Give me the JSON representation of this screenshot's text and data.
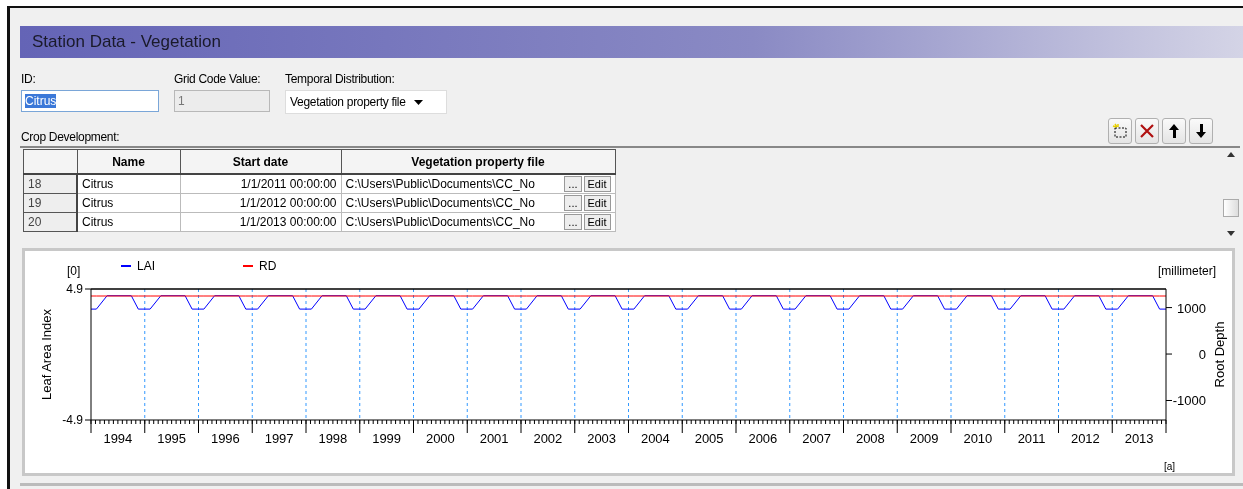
{
  "panel": {
    "title": "Station Data - Vegetation"
  },
  "fields": {
    "id": {
      "label": "ID:",
      "value": "Citrus",
      "selected": true
    },
    "grid_code": {
      "label": "Grid Code Value:",
      "value": "1",
      "disabled": true
    },
    "temporal_distribution": {
      "label": "Temporal Distribution:",
      "value": "Vegetation property file"
    }
  },
  "crop_development": {
    "label": "Crop Development:",
    "columns": [
      "Name",
      "Start date",
      "Vegetation property file"
    ],
    "rows": [
      {
        "index": "18",
        "name": "Citrus",
        "start_date": "1/1/2011 00:00:00",
        "file": "C:\\Users\\Public\\Documents\\CC_No",
        "browse": "...",
        "edit": "Edit"
      },
      {
        "index": "19",
        "name": "Citrus",
        "start_date": "1/1/2012 00:00:00",
        "file": "C:\\Users\\Public\\Documents\\CC_No",
        "browse": "...",
        "edit": "Edit"
      },
      {
        "index": "20",
        "name": "Citrus",
        "start_date": "1/1/2013 00:00:00",
        "file": "C:\\Users\\Public\\Documents\\CC_No",
        "browse": "...",
        "edit": "Edit"
      }
    ]
  },
  "chart": {
    "yunit": "[0]",
    "y2unit": "[millimeter]",
    "xunit": "[a]",
    "chart_data": {
      "type": "line",
      "ylabel": "Leaf Area Index",
      "y2label": "Root Depth",
      "legend": "top-left",
      "ref_lines": [
        {
          "axis": "x",
          "value": 1995,
          "color": "#3399ff"
        },
        {
          "axis": "x",
          "value": 1996,
          "color": "#3399ff"
        },
        {
          "axis": "x",
          "value": 1997,
          "color": "#3399ff"
        },
        {
          "axis": "x",
          "value": 1998,
          "color": "#3399ff"
        },
        {
          "axis": "x",
          "value": 1999,
          "color": "#3399ff"
        },
        {
          "axis": "x",
          "value": 2000,
          "color": "#3399ff"
        },
        {
          "axis": "x",
          "value": 2001,
          "color": "#3399ff"
        },
        {
          "axis": "x",
          "value": 2002,
          "color": "#3399ff"
        },
        {
          "axis": "x",
          "value": 2003,
          "color": "#3399ff"
        },
        {
          "axis": "x",
          "value": 2004,
          "color": "#3399ff"
        },
        {
          "axis": "x",
          "value": 2005,
          "color": "#3399ff"
        },
        {
          "axis": "x",
          "value": 2006,
          "color": "#3399ff"
        },
        {
          "axis": "x",
          "value": 2007,
          "color": "#3399ff"
        },
        {
          "axis": "x",
          "value": 2008,
          "color": "#3399ff"
        },
        {
          "axis": "x",
          "value": 2009,
          "color": "#3399ff"
        },
        {
          "axis": "x",
          "value": 2010,
          "color": "#3399ff"
        },
        {
          "axis": "x",
          "value": 2011,
          "color": "#3399ff"
        },
        {
          "axis": "x",
          "value": 2012,
          "color": "#3399ff"
        },
        {
          "axis": "x",
          "value": 2013,
          "color": "#3399ff"
        }
      ],
      "xlim": [
        1994,
        2014
      ],
      "ylim": [
        -4.9,
        4.9
      ],
      "y2lim": [
        -1420,
        1400
      ],
      "yticks": [
        4.9,
        -4.9
      ],
      "y2ticks": [
        1000,
        0,
        -1000
      ],
      "xticks": [
        {
          "value": 1994.5,
          "label": "1994"
        },
        {
          "value": 1995.5,
          "label": "1995"
        },
        {
          "value": 1996.5,
          "label": "1996"
        },
        {
          "value": 1997.5,
          "label": "1997"
        },
        {
          "value": 1998.5,
          "label": "1998"
        },
        {
          "value": 1999.5,
          "label": "1999"
        },
        {
          "value": 2000.5,
          "label": "2000"
        },
        {
          "value": 2001.5,
          "label": "2001"
        },
        {
          "value": 2002.5,
          "label": "2002"
        },
        {
          "value": 2003.5,
          "label": "2003"
        },
        {
          "value": 2004.5,
          "label": "2004"
        },
        {
          "value": 2005.5,
          "label": "2005"
        },
        {
          "value": 2006.5,
          "label": "2006"
        },
        {
          "value": 2007.5,
          "label": "2007"
        },
        {
          "value": 2008.5,
          "label": "2008"
        },
        {
          "value": 2009.5,
          "label": "2009"
        },
        {
          "value": 2010.5,
          "label": "2010"
        },
        {
          "value": 2011.5,
          "label": "2011"
        },
        {
          "value": 2012.5,
          "label": "2012"
        },
        {
          "value": 2013.5,
          "label": "2013"
        }
      ],
      "x": [
        1994,
        1994.1,
        1994.3,
        1994.75,
        1994.88,
        1995.1,
        1995.3,
        1995.75,
        1995.88,
        1996.1,
        1996.3,
        1996.75,
        1996.88,
        1997.1,
        1997.3,
        1997.75,
        1997.88,
        1998.1,
        1998.3,
        1998.75,
        1998.88,
        1999.1,
        1999.3,
        1999.75,
        1999.88,
        2000.1,
        2000.3,
        2000.75,
        2000.88,
        2001.1,
        2001.3,
        2001.75,
        2001.88,
        2002.1,
        2002.3,
        2002.75,
        2002.88,
        2003.1,
        2003.3,
        2003.75,
        2003.88,
        2004.1,
        2004.3,
        2004.75,
        2004.88,
        2005.1,
        2005.3,
        2005.75,
        2005.88,
        2006.1,
        2006.3,
        2006.75,
        2006.88,
        2007.1,
        2007.3,
        2007.75,
        2007.88,
        2008.1,
        2008.3,
        2008.75,
        2008.88,
        2009.1,
        2009.3,
        2009.75,
        2009.88,
        2010.1,
        2010.3,
        2010.75,
        2010.88,
        2011.1,
        2011.3,
        2011.75,
        2011.88,
        2012.1,
        2012.3,
        2012.75,
        2012.88,
        2013.1,
        2013.3,
        2013.75,
        2013.88,
        2014
      ],
      "series": [
        {
          "name": "LAI",
          "color": "#0000ff",
          "values": [
            3.4,
            3.4,
            4.4,
            4.4,
            3.4,
            3.4,
            4.4,
            4.4,
            3.4,
            3.4,
            4.4,
            4.4,
            3.4,
            3.4,
            4.4,
            4.4,
            3.4,
            3.4,
            4.4,
            4.4,
            3.4,
            3.4,
            4.4,
            4.4,
            3.4,
            3.4,
            4.4,
            4.4,
            3.4,
            3.4,
            4.4,
            4.4,
            3.4,
            3.4,
            4.4,
            4.4,
            3.4,
            3.4,
            4.4,
            4.4,
            3.4,
            3.4,
            4.4,
            4.4,
            3.4,
            3.4,
            4.4,
            4.4,
            3.4,
            3.4,
            4.4,
            4.4,
            3.4,
            3.4,
            4.4,
            4.4,
            3.4,
            3.4,
            4.4,
            4.4,
            3.4,
            3.4,
            4.4,
            4.4,
            3.4,
            3.4,
            4.4,
            4.4,
            3.4,
            3.4,
            4.4,
            4.4,
            3.4,
            3.4,
            4.4,
            4.4,
            3.4,
            3.4,
            4.4,
            4.4,
            3.4,
            3.4
          ]
        },
        {
          "name": "RD",
          "color": "#ff0000",
          "axis": "y2",
          "values": [
            1250,
            1250,
            1250,
            1250,
            1250,
            1250,
            1250,
            1250,
            1250,
            1250,
            1250,
            1250,
            1250,
            1250,
            1250,
            1250,
            1250,
            1250,
            1250,
            1250,
            1250,
            1250,
            1250,
            1250,
            1250,
            1250,
            1250,
            1250,
            1250,
            1250,
            1250,
            1250,
            1250,
            1250,
            1250,
            1250,
            1250,
            1250,
            1250,
            1250,
            1250,
            1250,
            1250,
            1250,
            1250,
            1250,
            1250,
            1250,
            1250,
            1250,
            1250,
            1250,
            1250,
            1250,
            1250,
            1250,
            1250,
            1250,
            1250,
            1250,
            1250,
            1250,
            1250,
            1250,
            1250,
            1250,
            1250,
            1250,
            1250,
            1250,
            1250,
            1250,
            1250,
            1250,
            1250,
            1250,
            1250,
            1250,
            1250,
            1250,
            1250,
            1250
          ]
        }
      ]
    }
  }
}
